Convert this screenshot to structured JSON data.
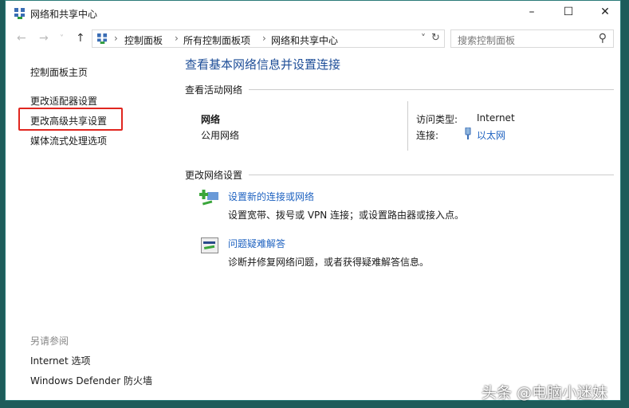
{
  "window": {
    "title": "网络和共享中心",
    "min": "–",
    "max": "☐",
    "close": "✕"
  },
  "nav": {
    "back": "←",
    "forward": "→",
    "dropdown": "˅",
    "up": "↑",
    "refresh": "↻",
    "addr_dropdown": "˅"
  },
  "breadcrumb": [
    "控制面板",
    "所有控制面板项",
    "网络和共享中心"
  ],
  "search": {
    "placeholder": "搜索控制面板",
    "icon": "⚲"
  },
  "sidebar": {
    "home": "控制面板主页",
    "items": [
      "更改适配器设置",
      "更改高级共享设置",
      "媒体流式处理选项"
    ],
    "see_also": "另请参阅",
    "see_also_items": [
      "Internet 选项",
      "Windows Defender 防火墙"
    ]
  },
  "main": {
    "heading": "查看基本网络信息并设置连接",
    "active_label": "查看活动网络",
    "network_name": "网络",
    "network_type": "公用网络",
    "access_label": "访问类型:",
    "access_value": "Internet",
    "conn_label": "连接:",
    "conn_value": "以太网",
    "change_label": "更改网络设置",
    "tasks": [
      {
        "title": "设置新的连接或网络",
        "desc": "设置宽带、拨号或 VPN 连接；或设置路由器或接入点。"
      },
      {
        "title": "问题疑难解答",
        "desc": "诊断并修复网络问题，或者获得疑难解答信息。"
      }
    ]
  },
  "watermark": "头条 @电脑小迷妹"
}
